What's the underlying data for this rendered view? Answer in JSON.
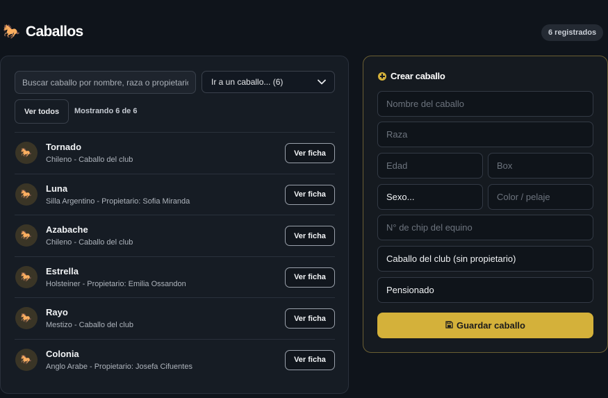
{
  "header": {
    "icon": "horse-icon",
    "title": "Caballos",
    "count_badge": "6 registrados"
  },
  "list_panel": {
    "search_placeholder": "Buscar caballo por nombre, raza o propietario",
    "goto_select": "Ir a un caballo... (6)",
    "show_all_button": "Ver todos",
    "showing_text": "Mostrando 6 de 6",
    "view_button_label": "Ver ficha",
    "items": [
      {
        "name": "Tornado",
        "details": "Chileno - Caballo del club"
      },
      {
        "name": "Luna",
        "details": "Silla Argentino - Propietario: Sofia Miranda"
      },
      {
        "name": "Azabache",
        "details": "Chileno - Caballo del club"
      },
      {
        "name": "Estrella",
        "details": "Holsteiner - Propietario: Emilia Ossandon"
      },
      {
        "name": "Rayo",
        "details": "Mestizo - Caballo del club"
      },
      {
        "name": "Colonia",
        "details": "Anglo Arabe - Propietario: Josefa Cifuentes"
      }
    ]
  },
  "form": {
    "title": "Crear caballo",
    "name_placeholder": "Nombre del caballo",
    "breed_placeholder": "Raza",
    "age_placeholder": "Edad",
    "box_placeholder": "Box",
    "sex_select": "Sexo...",
    "color_placeholder": "Color / pelaje",
    "chip_placeholder": "N° de chip del equino",
    "owner_select": "Caballo del club (sin propietario)",
    "status_select": "Pensionado",
    "save_button": "Guardar caballo"
  },
  "colors": {
    "accent": "#d4b13a",
    "background": "#0f141b",
    "panel": "#161c24"
  }
}
